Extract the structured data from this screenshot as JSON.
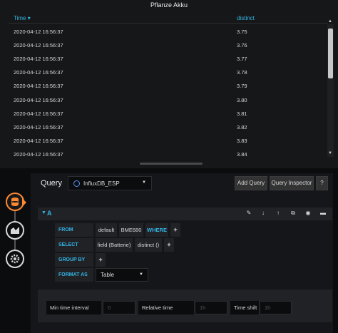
{
  "panel": {
    "title": "Pflanze Akku",
    "columns": {
      "time": "Time ▾",
      "value": "distinct"
    },
    "rows": [
      {
        "time": "2020-04-12 16:56:37",
        "value": "3.75"
      },
      {
        "time": "2020-04-12 16:56:37",
        "value": "3.76"
      },
      {
        "time": "2020-04-12 16:56:37",
        "value": "3.77"
      },
      {
        "time": "2020-04-12 16:56:37",
        "value": "3.78"
      },
      {
        "time": "2020-04-12 16:56:37",
        "value": "3.79"
      },
      {
        "time": "2020-04-12 16:56:37",
        "value": "3.80"
      },
      {
        "time": "2020-04-12 16:56:37",
        "value": "3.81"
      },
      {
        "time": "2020-04-12 16:56:37",
        "value": "3.82"
      },
      {
        "time": "2020-04-12 16:56:37",
        "value": "3.83"
      },
      {
        "time": "2020-04-12 16:56:37",
        "value": "3.84"
      }
    ]
  },
  "editor": {
    "query_label": "Query",
    "datasource": "InfluxDB_ESP",
    "add_query": "Add Query",
    "query_inspector": "Query Inspector",
    "help": "?",
    "query_ref": "A",
    "from": {
      "label": "FROM",
      "policy": "default",
      "measurement": "BME680",
      "where": "WHERE",
      "plus": "+"
    },
    "select": {
      "label": "SELECT",
      "field": "field (Batterie)",
      "fn": "distinct ()",
      "plus": "+"
    },
    "group_by": {
      "label": "GROUP BY",
      "plus": "+"
    },
    "format_as": {
      "label": "FORMAT AS",
      "value": "Table"
    },
    "options": {
      "min_interval_label": "Min time interval",
      "min_interval_placeholder": "0",
      "relative_time_label": "Relative time",
      "relative_time_placeholder": "1h",
      "time_shift_label": "Time shift",
      "time_shift_placeholder": "1h"
    }
  },
  "colors": {
    "accent": "#33b5e5",
    "active": "#ff8833",
    "background": "#161719"
  },
  "icons": [
    "database-icon",
    "chart-area-icon",
    "gear-icon",
    "pencil-icon",
    "arrow-down-icon",
    "arrow-up-icon",
    "copy-icon",
    "eye-icon",
    "trash-icon",
    "chevron-down-icon"
  ]
}
